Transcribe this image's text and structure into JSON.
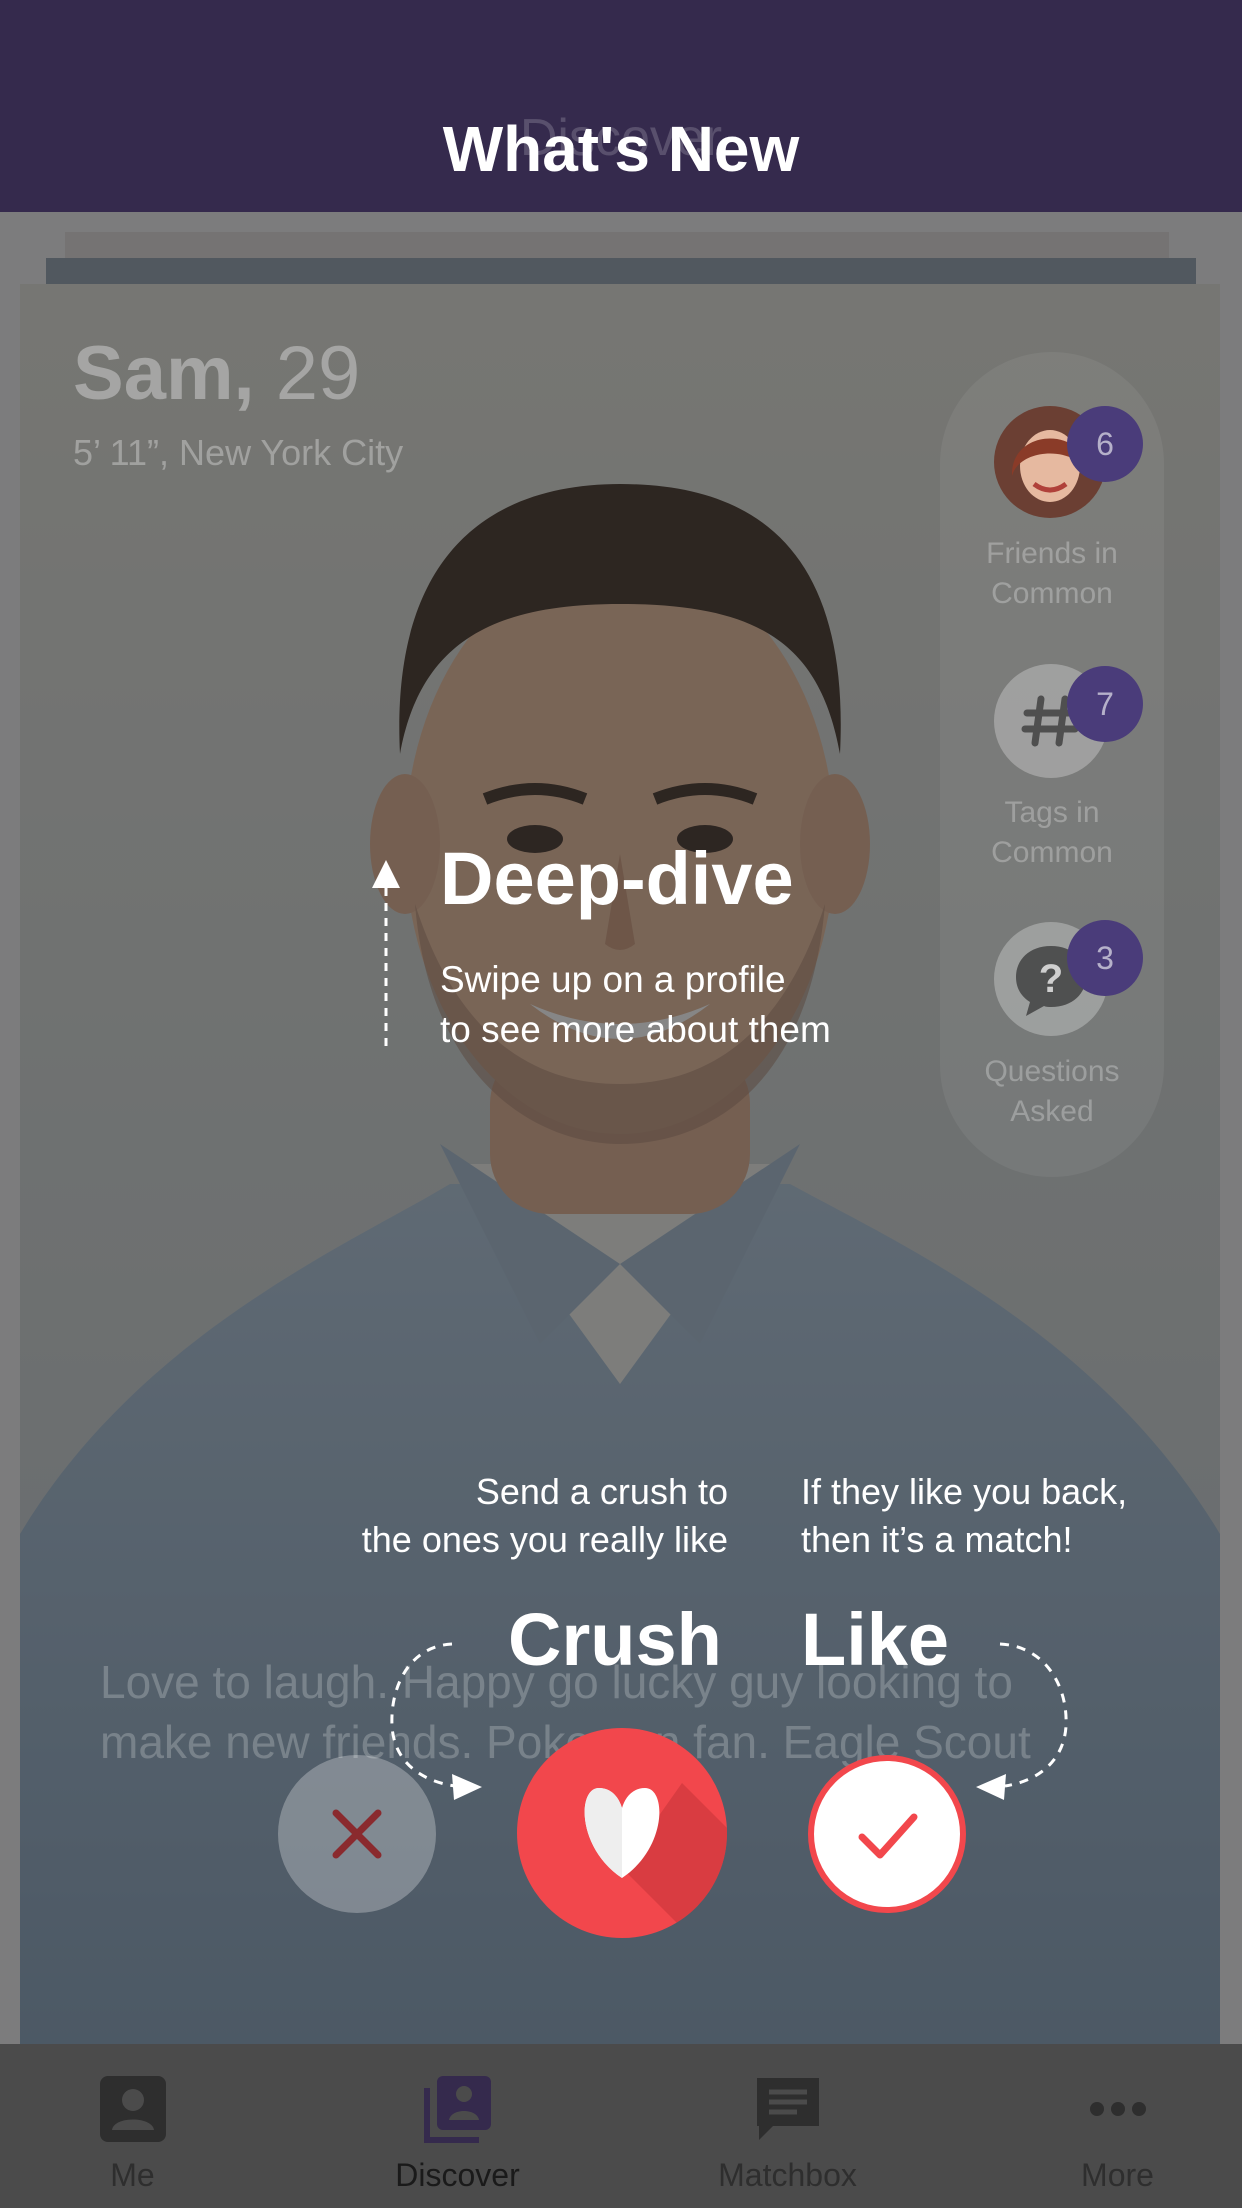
{
  "header": {
    "title": "What's New",
    "underlying_title": "Discover"
  },
  "profile": {
    "name": "Sam,",
    "age": "29",
    "details": "5’ 11”, New York City",
    "bio_line1": "Love to laugh. Happy go lucky guy looking to",
    "bio_line2": "make new friends. Pokemon fan. Eagle Scout"
  },
  "side_panel": {
    "friends": {
      "count": "6",
      "label_line1": "Friends in",
      "label_line2": "Common"
    },
    "tags": {
      "count": "7",
      "label_line1": "Tags in",
      "label_line2": "Common"
    },
    "questions": {
      "count": "3",
      "label_line1": "Questions",
      "label_line2": "Asked"
    }
  },
  "tutorial": {
    "deep_dive": {
      "title": "Deep-dive",
      "line1": "Swipe up on a profile",
      "line2": "to see more about them"
    },
    "crush": {
      "title": "Crush",
      "line1": "Send a crush to",
      "line2": "the ones you really like"
    },
    "like": {
      "title": "Like",
      "line1": "If they like you back,",
      "line2": "then it’s a match!"
    }
  },
  "tabs": [
    {
      "label": "Me",
      "icon": "person-icon",
      "active": false
    },
    {
      "label": "Discover",
      "icon": "cards-icon",
      "active": true
    },
    {
      "label": "Matchbox",
      "icon": "chat-icon",
      "active": false
    },
    {
      "label": "More",
      "icon": "more-icon",
      "active": false
    }
  ],
  "colors": {
    "header": "#352a4d",
    "accent": "#f2474c",
    "badge": "#4a3c7a"
  }
}
